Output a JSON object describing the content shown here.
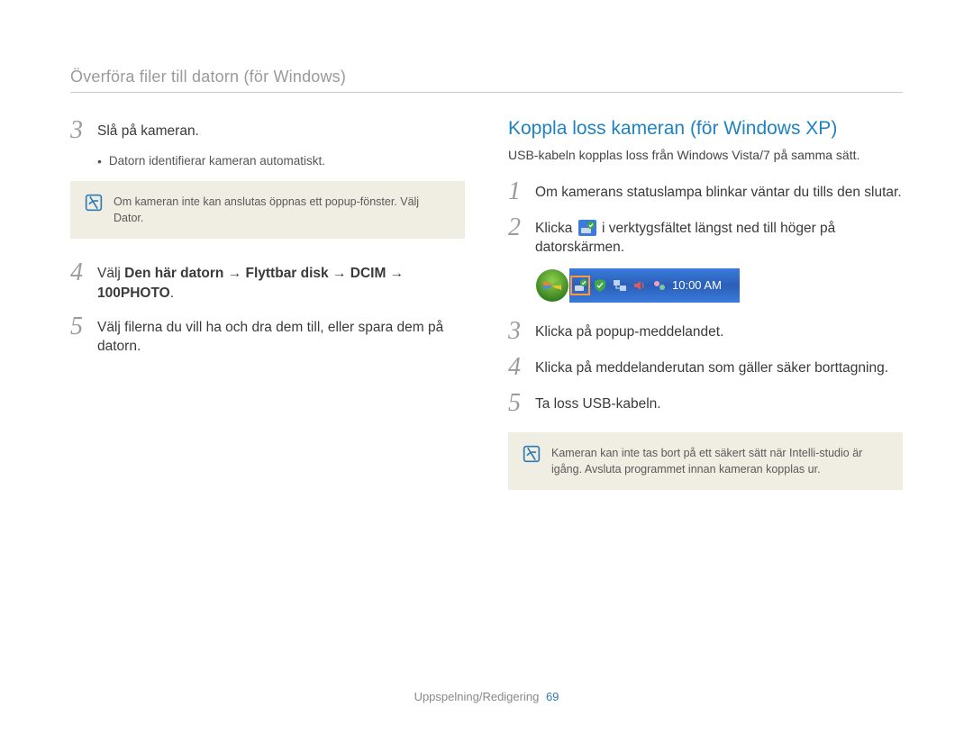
{
  "header": {
    "title": "Överföra filer till datorn (för Windows)"
  },
  "left": {
    "step3": {
      "num": "3",
      "text": "Slå på kameran."
    },
    "step3_sub": "Datorn identifierar kameran automatiskt.",
    "note1_pre": "Om kameran inte kan anslutas öppnas ett popup-fönster. Välj ",
    "note1_bold": "Dator",
    "note1_post": ".",
    "step4": {
      "num": "4",
      "pre": "Välj ",
      "bold": "Den här datorn → Flyttbar disk → DCIM → 100PHOTO",
      "post": "."
    },
    "step5": {
      "num": "5",
      "text": "Välj filerna du vill ha och dra dem till, eller spara dem på datorn."
    }
  },
  "right": {
    "title": "Koppla loss kameran (för Windows XP)",
    "sub": "USB-kabeln kopplas loss från Windows Vista/7 på samma sätt.",
    "step1": {
      "num": "1",
      "text": "Om kamerans statuslampa blinkar väntar du tills den slutar."
    },
    "step2": {
      "num": "2",
      "pre": "Klicka ",
      "post": " i verktygsfältet längst ned till höger på datorskärmen."
    },
    "taskbar_time": "10:00 AM",
    "step3": {
      "num": "3",
      "text": "Klicka på popup-meddelandet."
    },
    "step4": {
      "num": "4",
      "text": "Klicka på meddelanderutan som gäller säker borttagning."
    },
    "step5": {
      "num": "5",
      "text": "Ta loss USB-kabeln."
    },
    "note2": "Kameran kan inte tas bort på ett säkert sätt när Intelli-studio är igång. Avsluta programmet innan kameran kopplas ur."
  },
  "footer": {
    "section": "Uppspelning/Redigering",
    "page": "69"
  }
}
